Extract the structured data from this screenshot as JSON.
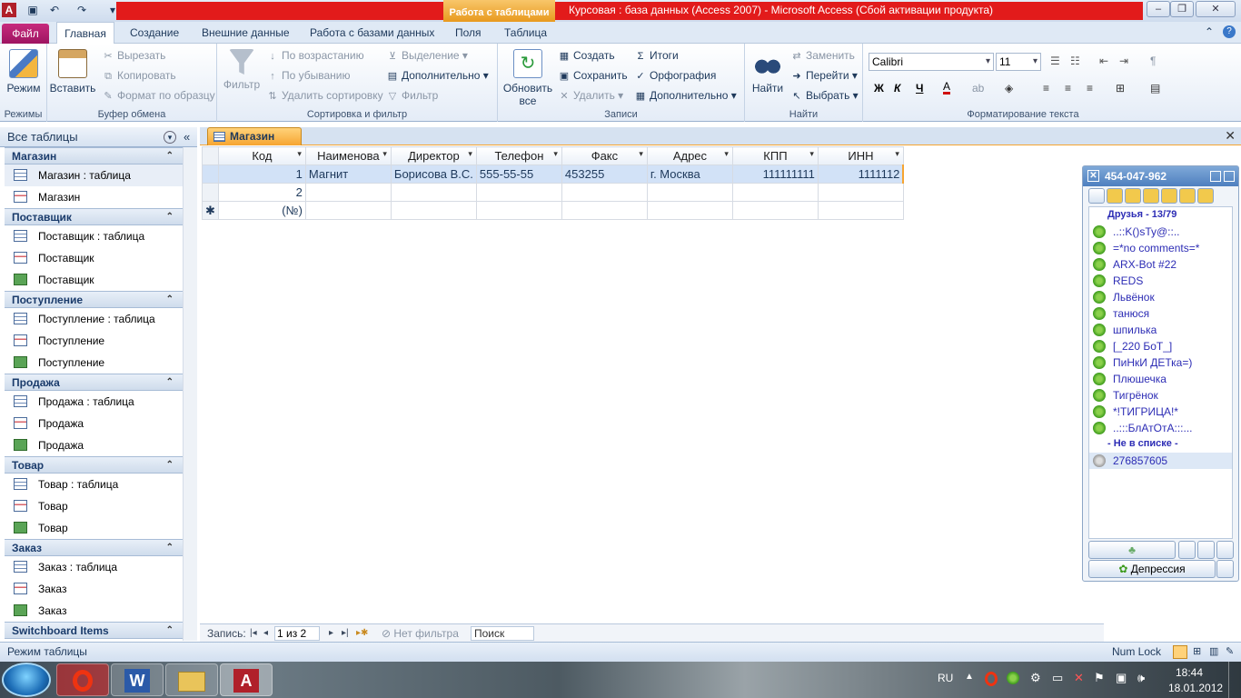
{
  "titlebar": {
    "context_tab": "Работа с таблицами",
    "app_title": "Курсовая : база данных (Access 2007)  -  Microsoft Access (Сбой активации продукта)"
  },
  "tabs": {
    "file": "Файл",
    "items": [
      "Главная",
      "Создание",
      "Внешние данные",
      "Работа с базами данных",
      "Поля",
      "Таблица"
    ]
  },
  "ribbon": {
    "groups": {
      "views": "Режимы",
      "clipboard": "Буфер обмена",
      "sort_filter": "Сортировка и фильтр",
      "records": "Записи",
      "find": "Найти",
      "text_format": "Форматирование текста"
    },
    "view_btn": "Режим",
    "paste_btn": "Вставить",
    "cut": "Вырезать",
    "copy": "Копировать",
    "format_painter": "Формат по образцу",
    "filter_btn": "Фильтр",
    "sort_asc": "По возрастанию",
    "sort_desc": "По убыванию",
    "remove_sort": "Удалить сортировку",
    "selection": "Выделение",
    "advanced": "Дополнительно",
    "toggle_filter": "Фильтр",
    "refresh_btn_1": "Обновить",
    "refresh_btn_2": "все",
    "new": "Создать",
    "save": "Сохранить",
    "delete": "Удалить",
    "totals": "Итоги",
    "spelling": "Орфография",
    "more": "Дополнительно",
    "find_btn": "Найти",
    "replace": "Заменить",
    "goto": "Перейти",
    "select": "Выбрать",
    "font_name": "Calibri",
    "font_size": "11"
  },
  "nav": {
    "header": "Все таблицы",
    "groups": [
      {
        "name": "Магазин",
        "items": [
          "Магазин : таблица",
          "Магазин"
        ]
      },
      {
        "name": "Поставщик",
        "items": [
          "Поставщик : таблица",
          "Поставщик",
          "Поставщик"
        ]
      },
      {
        "name": "Поступление",
        "items": [
          "Поступление : таблица",
          "Поступление",
          "Поступление"
        ]
      },
      {
        "name": "Продажа",
        "items": [
          "Продажа : таблица",
          "Продажа",
          "Продажа"
        ]
      },
      {
        "name": "Товар",
        "items": [
          "Товар : таблица",
          "Товар",
          "Товар"
        ]
      },
      {
        "name": "Заказ",
        "items": [
          "Заказ : таблица",
          "Заказ",
          "Заказ"
        ]
      },
      {
        "name": "Switchboard Items",
        "items": []
      }
    ]
  },
  "doc": {
    "tab": "Магазин",
    "columns": [
      "Код",
      "Наименова",
      "Директор",
      "Телефон",
      "Факс",
      "Адрес",
      "КПП",
      "ИНН"
    ],
    "rows": [
      [
        "1",
        "Магнит",
        "Борисова В.С.",
        "555-55-55",
        "453255",
        "г. Москва",
        "111111111",
        "1111112"
      ],
      [
        "2",
        "",
        "",
        "",
        "",
        "",
        "",
        ""
      ],
      [
        "(№)",
        "",
        "",
        "",
        "",
        "",
        "",
        ""
      ]
    ]
  },
  "recnav": {
    "label": "Запись:",
    "position": "1 из 2",
    "filter": "Нет фильтра",
    "search": "Поиск"
  },
  "status": {
    "mode": "Режим таблицы",
    "numlock": "Num Lock"
  },
  "taskbar": {
    "lang": "RU",
    "time": "18:44",
    "date": "18.01.2012"
  },
  "icq": {
    "uin": "454-047-962",
    "friends_group": "Друзья - 13/79",
    "contacts": [
      "..::K()sTy@::..",
      "=*no comments=*",
      "ARX-Bot #22",
      "REDS",
      "Львёнок",
      "танюся",
      "шпилька",
      "[_220 БоТ_]",
      "ПиНкИ ДЕТка=)",
      "Плюшечка",
      "Тигрёнок",
      "*!ТИГРИЦА!*",
      "..:::БлАтОтА:::..."
    ],
    "not_in_list": "- Не в списке -",
    "unknown_contact": "276857605",
    "status_btn": "Депрессия"
  }
}
